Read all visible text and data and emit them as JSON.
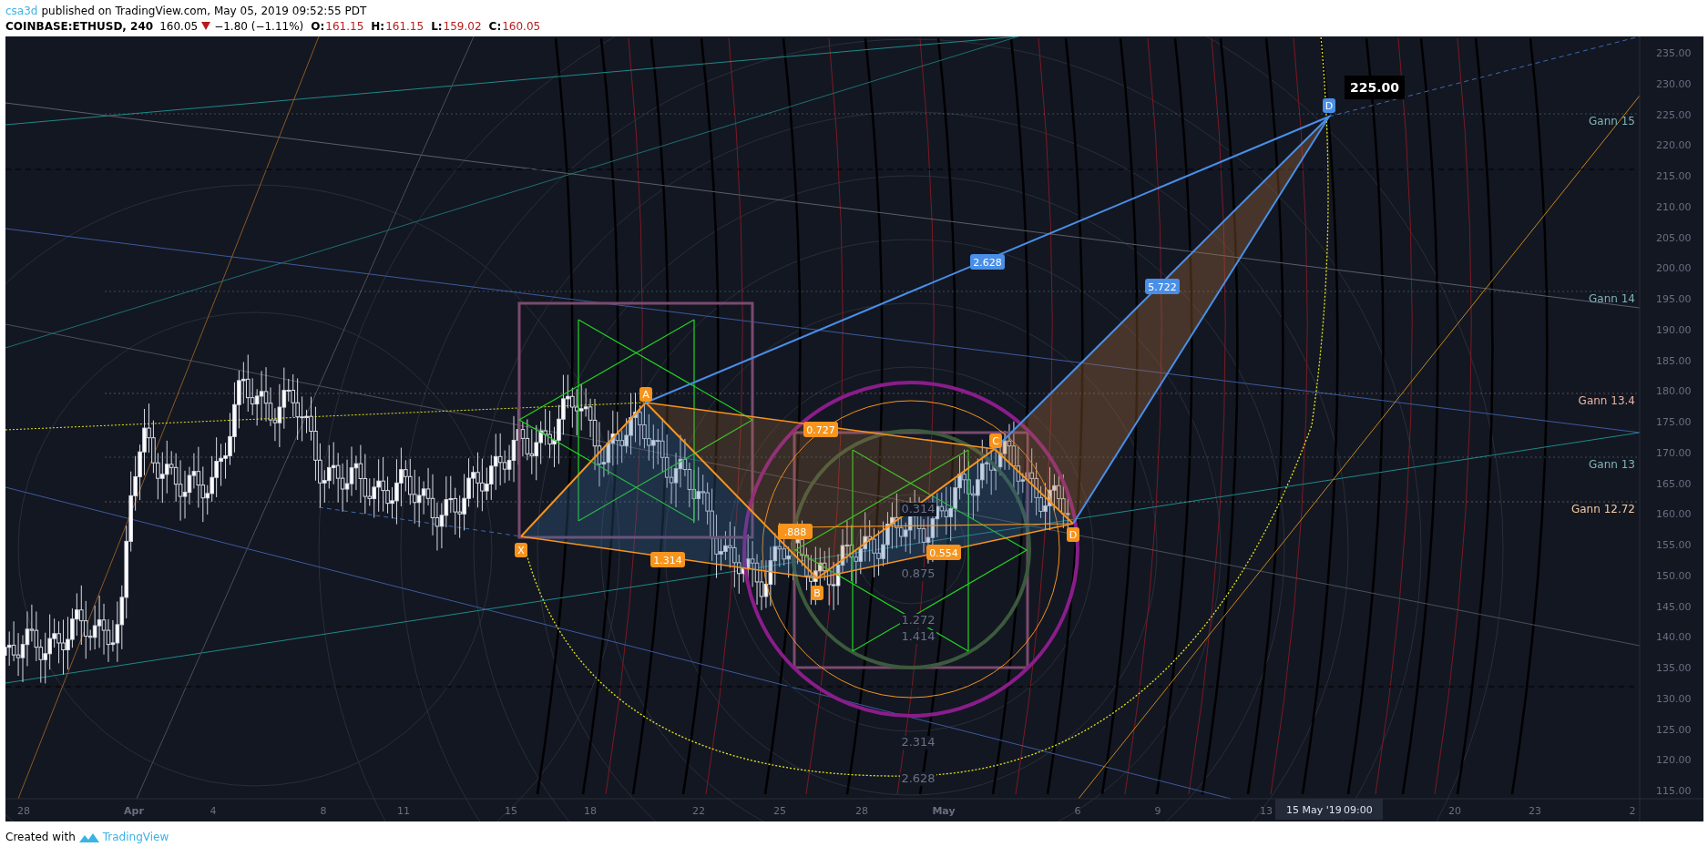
{
  "header": {
    "author": "csa3d",
    "published": "published on TradingView.com, May 05, 2019 09:52:55 PDT"
  },
  "symbol_bar": {
    "symbol": "COINBASE:ETHUSD, 240",
    "last": "160.05",
    "change": "−1.80 (−1.11%)",
    "ohlc": [
      {
        "label": "O:",
        "value": "161.15"
      },
      {
        "label": "H:",
        "value": "161.15"
      },
      {
        "label": "L:",
        "value": "159.02"
      },
      {
        "label": "C:",
        "value": "160.05"
      }
    ]
  },
  "chart": {
    "price_axis": [
      "235.00",
      "230.00",
      "225.00",
      "220.00",
      "215.00",
      "210.00",
      "205.00",
      "200.00",
      "195.00",
      "190.00",
      "185.00",
      "180.00",
      "175.00",
      "170.00",
      "165.00",
      "160.00",
      "155.00",
      "150.00",
      "145.00",
      "140.00",
      "135.00",
      "130.00",
      "125.00",
      "120.00",
      "115.00"
    ],
    "time_axis": [
      {
        "label": "28",
        "kind": "day"
      },
      {
        "label": "Apr",
        "kind": "month"
      },
      {
        "label": "4",
        "kind": "day"
      },
      {
        "label": "8",
        "kind": "day"
      },
      {
        "label": "11",
        "kind": "day"
      },
      {
        "label": "15",
        "kind": "day"
      },
      {
        "label": "18",
        "kind": "day"
      },
      {
        "label": "22",
        "kind": "day"
      },
      {
        "label": "25",
        "kind": "day"
      },
      {
        "label": "28",
        "kind": "day"
      },
      {
        "label": "May",
        "kind": "month"
      },
      {
        "label": "6",
        "kind": "day"
      },
      {
        "label": "9",
        "kind": "day"
      },
      {
        "label": "13",
        "kind": "day"
      },
      {
        "label": "20",
        "kind": "day"
      },
      {
        "label": "23",
        "kind": "day"
      },
      {
        "label": "2",
        "kind": "day"
      }
    ],
    "crosshair": {
      "date": "15 May '19",
      "time": "09:00"
    },
    "price_tag": "225.00",
    "gann_levels": [
      {
        "label": "Gann 15",
        "color": "#7fb3b8"
      },
      {
        "label": "Gann 14",
        "color": "#7fb3b8"
      },
      {
        "label": "Gann 13.4",
        "color": "#e8b4a4"
      },
      {
        "label": "Gann 13",
        "color": "#7fb3b8"
      },
      {
        "label": "Gann 12.72",
        "color": "#f2c9a0"
      }
    ],
    "pattern_points": [
      {
        "label": "X",
        "color": "#f7941d"
      },
      {
        "label": "A",
        "color": "#f7941d"
      },
      {
        "label": "B",
        "color": "#f7941d"
      },
      {
        "label": "C",
        "color": "#f7941d"
      },
      {
        "label": "D",
        "color": "#f7941d"
      },
      {
        "label": "D",
        "color": "#4a8fe7"
      }
    ],
    "ratios": [
      {
        "label": "1.314",
        "color": "#f7941d"
      },
      {
        "label": "0.727",
        "color": "#f7941d"
      },
      {
        "label": ".888",
        "color": "#f7941d"
      },
      {
        "label": "0.554",
        "color": "#f7941d"
      },
      {
        "label": "2.628",
        "color": "#4a8fe7"
      },
      {
        "label": "5.722",
        "color": "#4a8fe7"
      }
    ],
    "fib_labels": [
      "0.314",
      "0.875",
      "1.272",
      "1.414",
      "2.314",
      "2.628"
    ]
  },
  "footer": {
    "text": "Created with",
    "brand": "TradingView"
  }
}
